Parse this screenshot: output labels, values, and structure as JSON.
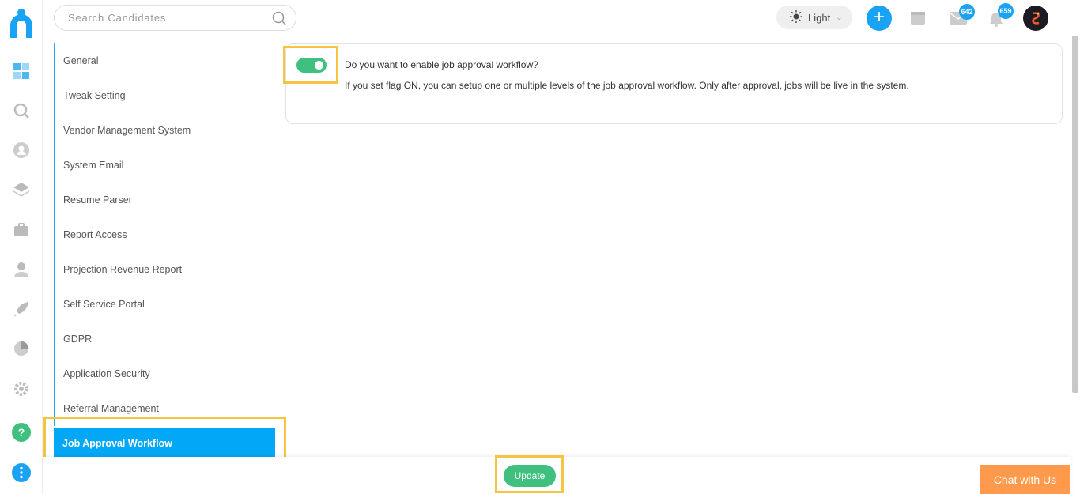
{
  "search": {
    "placeholder": "Search Candidates"
  },
  "header": {
    "theme_label": "Light",
    "mail_count": "642",
    "notification_count": "659"
  },
  "settings_nav": {
    "items": [
      {
        "label": "General"
      },
      {
        "label": "Tweak Setting"
      },
      {
        "label": "Vendor Management System"
      },
      {
        "label": "System Email"
      },
      {
        "label": "Resume Parser"
      },
      {
        "label": "Report Access"
      },
      {
        "label": "Projection Revenue Report"
      },
      {
        "label": "Self Service Portal"
      },
      {
        "label": "GDPR"
      },
      {
        "label": "Application Security"
      },
      {
        "label": "Referral Management"
      },
      {
        "label": "Job Approval Workflow",
        "active": true
      }
    ]
  },
  "job_approval": {
    "enabled": true,
    "question": "Do you want to enable job approval workflow?",
    "description": "If you set flag ON, you can setup one or multiple levels of the job approval workflow. Only after approval, jobs will be live in the system."
  },
  "footer": {
    "update_label": "Update",
    "chat_label": "Chat with Us"
  },
  "colors": {
    "accent": "#02a8f6",
    "success": "#3fc07f",
    "highlight": "#f5c542",
    "chat": "#ff9a4d"
  }
}
